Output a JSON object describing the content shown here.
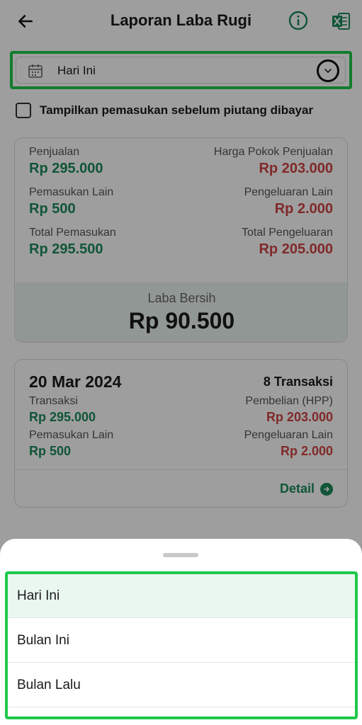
{
  "header": {
    "title": "Laporan Laba Rugi",
    "back_icon": "arrow-left-icon",
    "info_icon": "info-icon",
    "excel_icon": "excel-icon"
  },
  "period": {
    "value": "Hari Ini",
    "icon": "calendar-icon"
  },
  "checkbox": {
    "label": "Tampilkan pemasukan sebelum piutang dibayar",
    "checked": false
  },
  "summary": {
    "penjualan_label": "Penjualan",
    "penjualan_value": "Rp 295.000",
    "hpp_label": "Harga Pokok Penjualan",
    "hpp_value": "Rp 203.000",
    "pemasukan_lain_label": "Pemasukan Lain",
    "pemasukan_lain_value": "Rp 500",
    "pengeluaran_lain_label": "Pengeluaran Lain",
    "pengeluaran_lain_value": "Rp 2.000",
    "total_pemasukan_label": "Total Pemasukan",
    "total_pemasukan_value": "Rp 295.500",
    "total_pengeluaran_label": "Total Pengeluaran",
    "total_pengeluaran_value": "Rp 205.000",
    "laba_label": "Laba Bersih",
    "laba_value": "Rp 90.500"
  },
  "day": {
    "date": "20 Mar 2024",
    "count": "8 Transaksi",
    "transaksi_label": "Transaksi",
    "transaksi_value": "Rp 295.000",
    "pembelian_label": "Pembelian (HPP)",
    "pembelian_value": "Rp 203.000",
    "pemasukan_lain_label": "Pemasukan Lain",
    "pemasukan_lain_value": "Rp 500",
    "pengeluaran_lain_label": "Pengeluaran Lain",
    "pengeluaran_lain_value": "Rp 2.000",
    "detail_label": "Detail"
  },
  "sheet": {
    "options": [
      "Hari Ini",
      "Bulan Ini",
      "Bulan Lalu"
    ],
    "selected": "Hari Ini"
  },
  "colors": {
    "green": "#1b8a5a",
    "red": "#d14343",
    "highlight": "#1ec94a"
  }
}
